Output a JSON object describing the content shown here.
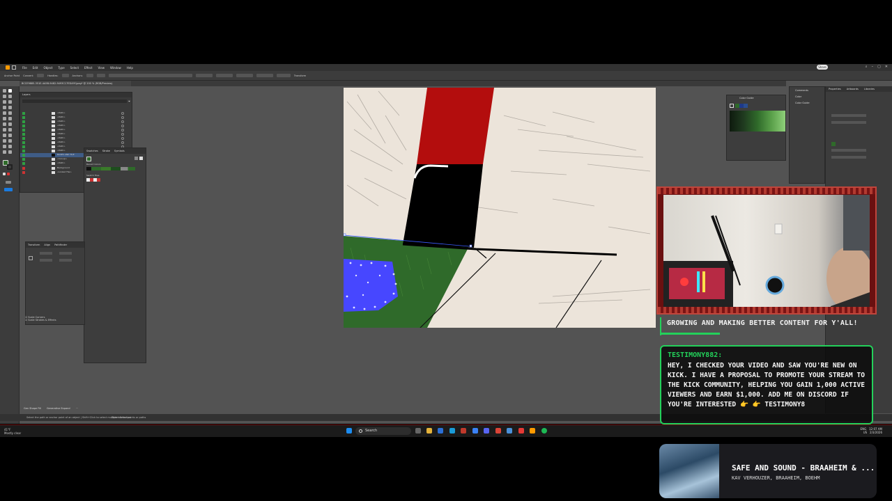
{
  "app": {
    "menu": [
      "File",
      "Edit",
      "Object",
      "Type",
      "Select",
      "Effect",
      "View",
      "Window",
      "Help"
    ],
    "share_label": "Share",
    "control_bar": [
      "Anchor Point",
      "Convert:",
      "Handles:",
      "Anchors:",
      "Transform"
    ],
    "doc_tab": "BCCE9885-351E-4A5B-9482-9493C17ED49F.jpeg* @ 200 % (RGB/Preview)",
    "layers_panel_title": "Layers",
    "layers": [
      "<Path>",
      "<Path>",
      "<Path>",
      "<Path>",
      "<Path>",
      "<Path>",
      "<Path>",
      "<Path>",
      "<Path>",
      "<Path>",
      "BASES AND TILE",
      "<Group>",
      "<Path>",
      "Background",
      "<Linked File>"
    ],
    "swatches_tabs": [
      "Swatches",
      "Stroke",
      "Symbols"
    ],
    "swatches_labels": [
      "Recent Colors",
      "Swatch Files"
    ],
    "transform_tabs": [
      "Transform",
      "Align",
      "Pathfinder"
    ],
    "scale_options": [
      "Scale Corners",
      "Scale Strokes & Effects"
    ],
    "bottom_buttons": [
      "Gen Shape Fill",
      "Generative Expand"
    ],
    "status_text": "Select the path or anchor point of an object | Shift+Click to select multiple anchor points or paths",
    "status_right": "Direct Selection",
    "right_tabs": [
      "Properties",
      "Artboards",
      "Libraries"
    ],
    "cc_panel": [
      "Comments",
      "Color",
      "Color Guide"
    ],
    "color_guide_title": "Color Guide",
    "colors": {
      "red": "#b30d0d",
      "black": "#000000",
      "grass": "#2f6a2a",
      "selection": "#4747ff",
      "canvas": "#ece4da"
    }
  },
  "taskbar": {
    "weather_temp": "41°F",
    "weather_desc": "Mostly clear",
    "search_placeholder": "Search",
    "lang": "ENG",
    "region": "US",
    "time": "12:07 AM",
    "date": "2/3/2026"
  },
  "overlay": {
    "goal_text": "GROWING AND MAKING BETTER CONTENT FOR Y'ALL!",
    "goal_progress": 0.28,
    "chat_user": "TESTIMONY882:",
    "chat_message": "HEY, I CHECKED YOUR VIDEO AND SAW YOU'RE NEW ON KICK. I HAVE A PROPOSAL TO PROMOTE YOUR STREAM TO THE KICK COMMUNITY, HELPING YOU GAIN 1,000 ACTIVE VIEWERS AND EARN $1,000. ADD ME ON DISCORD IF YOU'RE INTERESTED 👉 👉 TESTIMONY8",
    "song_title": "SAFE AND SOUND - BRAAHEIM & ...",
    "song_artist": "KAV VERHOUZER, BRAAHEIM, BOEHM",
    "accent": "#23d15a"
  }
}
